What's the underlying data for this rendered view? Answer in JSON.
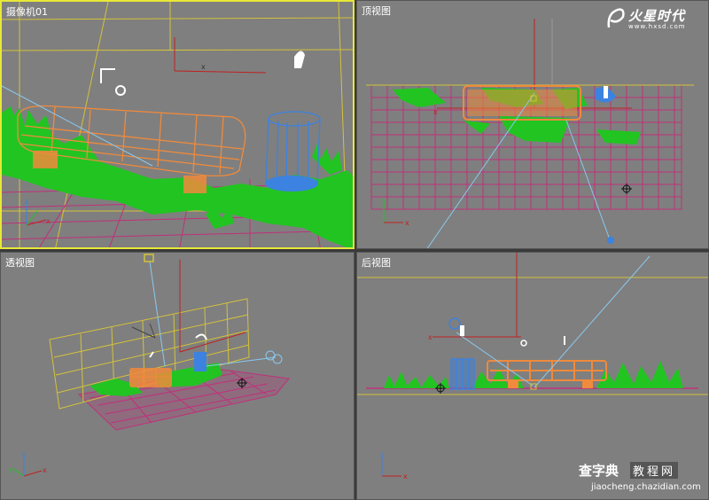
{
  "viewports": {
    "camera": {
      "label": "摄像机01",
      "active": true
    },
    "top": {
      "label": "顶视图"
    },
    "perspective": {
      "label": "透视图"
    },
    "back": {
      "label": "后视图"
    }
  },
  "axes": {
    "x": "x",
    "y": "y",
    "z": "z"
  },
  "logo": {
    "brand": "火星时代",
    "url": "www.hxsd.com"
  },
  "watermark": {
    "brand": "查字典",
    "tag": "教程网",
    "url": "jiaocheng.chazidian.com"
  },
  "colors": {
    "viewport_bg": "#7f7f7f",
    "active_border": "#e8e838",
    "grass": "#22c422",
    "bench": "#f08a3c",
    "grid": "#c0307a",
    "bin": "#3c82e0",
    "camera_line": "#8ac8ee",
    "frame_line": "#d4c23a"
  }
}
